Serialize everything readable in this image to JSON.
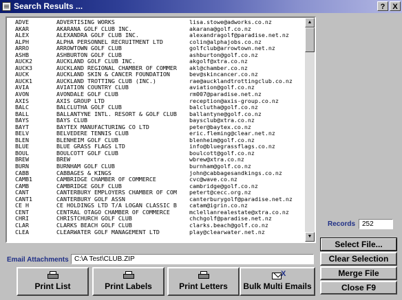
{
  "window": {
    "title": "Search Results ...",
    "help_label": "?",
    "close_label": "X"
  },
  "results": [
    {
      "code": "ADVE",
      "name": "ADVERTISING WORKS",
      "email": "lisa.stowe@adworks.co.nz"
    },
    {
      "code": "AKAR",
      "name": "AKARANA GOLF CLUB INC.",
      "email": "akarana@golf.co.nz"
    },
    {
      "code": "ALEX",
      "name": "ALEXANDRA GOLF CLUB INC.",
      "email": "alexandragolf@paradise.net.nz"
    },
    {
      "code": "ALPH",
      "name": "ALPHA PERSONNEL RECRUITMENT LTD",
      "email": "colin@alphajobs.co.nz"
    },
    {
      "code": "ARRO",
      "name": "ARROWTOWN GOLF CLUB",
      "email": "golfclub@arrowtown.net.nz"
    },
    {
      "code": "ASHB",
      "name": "ASHBURTON GOLF CLUB",
      "email": "ashburton@golf.co.nz"
    },
    {
      "code": "AUCK2",
      "name": "AUCKLAND GOLF CLUB INC.",
      "email": "akgolf@xtra.co.nz"
    },
    {
      "code": "AUCK3",
      "name": "AUCKLAND REGIONAL CHAMBER OF COMMER",
      "email": "akl@chamber.co.nz"
    },
    {
      "code": "AUCK",
      "name": "AUCKLAND SKIN & CANCER FOUNDATION",
      "email": "bev@skincancer.co.nz"
    },
    {
      "code": "AUCK1",
      "name": "AUCKLAND TROTTING CLUB (INC.)",
      "email": "rae@aucklandtrottingclub.co.nz"
    },
    {
      "code": "AVIA",
      "name": "AVIATION COUNTRY CLUB",
      "email": "aviation@golf.co.nz"
    },
    {
      "code": "AVON",
      "name": "AVONDALE GOLF CLUB",
      "email": "rm007@paradise.net.nz"
    },
    {
      "code": "AXIS",
      "name": "AXIS GROUP LTD",
      "email": "reception@axis-group.co.nz"
    },
    {
      "code": "BALC",
      "name": "BALCLUTHA GOLF CLUB",
      "email": "balclutha@golf.co.nz"
    },
    {
      "code": "BALL",
      "name": "BALLANTYNE INTL. RESORT & GOLF CLUB",
      "email": "ballantyne@golf.co.nz"
    },
    {
      "code": "BAYS",
      "name": "BAYS CLUB",
      "email": "baysclub@xtra.co.nz"
    },
    {
      "code": "BAYT",
      "name": "BAYTEX MANUFACTURING CO LTD",
      "email": "peter@baytex.co.nz"
    },
    {
      "code": "BELV",
      "name": "BELVEDERE TENNIS CLUB",
      "email": "eric.fleming@clear.net.nz"
    },
    {
      "code": "BLEN",
      "name": "BLENHEIM GOLF CLUB",
      "email": "blenheim@golf.co.nz"
    },
    {
      "code": "BLUE",
      "name": "BLUE GRASS FLAGS LTD",
      "email": "info@bluegrassflags.co.nz"
    },
    {
      "code": "BOUL",
      "name": "BOULCOTT GOLF CLUB",
      "email": "boulcott@golf.co.nz"
    },
    {
      "code": "BREW",
      "name": "BREW",
      "email": "wbrew@xtra.co.nz"
    },
    {
      "code": "BURN",
      "name": "BURNHAM GOLF CLUB",
      "email": "burnham@golf.co.nz"
    },
    {
      "code": "CABB",
      "name": "CABBAGES & KINGS",
      "email": "john@cabbagesandkings.co.nz"
    },
    {
      "code": "CAMB1",
      "name": "CAMBRIDGE CHAMBER OF COMMERCE",
      "email": "cvc@wave.co.nz"
    },
    {
      "code": "CAMB",
      "name": "CAMBRIDGE GOLF CLUB",
      "email": "cambridge@golf.co.nz"
    },
    {
      "code": "CANT",
      "name": "CANTERBURY EMPLOYERS CHAMBER OF COM",
      "email": "petert@cecc.org.nz"
    },
    {
      "code": "CANT1",
      "name": "CANTERBURY GOLF ASSN",
      "email": "canterburygolf@paradise.net.nz"
    },
    {
      "code": "CE H",
      "name": "CE HOLDINGS LTD T/A LOGAN CLASSIC B",
      "email": "catam@igrin.co.nz"
    },
    {
      "code": "CENT",
      "name": "CENTRAL OTAGO CHAMBER OF COMMERCE",
      "email": "mclellanrealestate@xtra.co.nz"
    },
    {
      "code": "CHRI",
      "name": "CHRISTCHURCH GOLF CLUB",
      "email": "chchgolf@paradise.net.nz"
    },
    {
      "code": "CLAR",
      "name": "CLARKS BEACH GOLF CLUB",
      "email": "clarks.beach@golf.co.nz"
    },
    {
      "code": "CLEA",
      "name": "CLEARWATER GOLF MANAGEMENT LTD",
      "email": "play@clearwater.net.nz"
    }
  ],
  "records": {
    "label": "Records",
    "value": "252"
  },
  "right_buttons": {
    "select_file": "Select File...",
    "clear_selection": "Clear Selection",
    "merge_file": "Merge File",
    "close": "Close F9"
  },
  "attachments": {
    "label": "Email Attachments",
    "value": "C:\\A Test\\CLUB.ZIP"
  },
  "bottom_buttons": {
    "print_list": "Print List",
    "print_labels": "Print Labels",
    "print_letters": "Print Letters",
    "bulk_emails": "Bulk Multi Emails"
  },
  "colors": {
    "title_start": "#0a1a6e",
    "title_end": "#b4b8e4",
    "label_blue": "#1f2f86",
    "face": "#c0c0c0"
  },
  "icons": {
    "window": "list-icon",
    "print": "printer-icon",
    "email": "email-icon"
  }
}
